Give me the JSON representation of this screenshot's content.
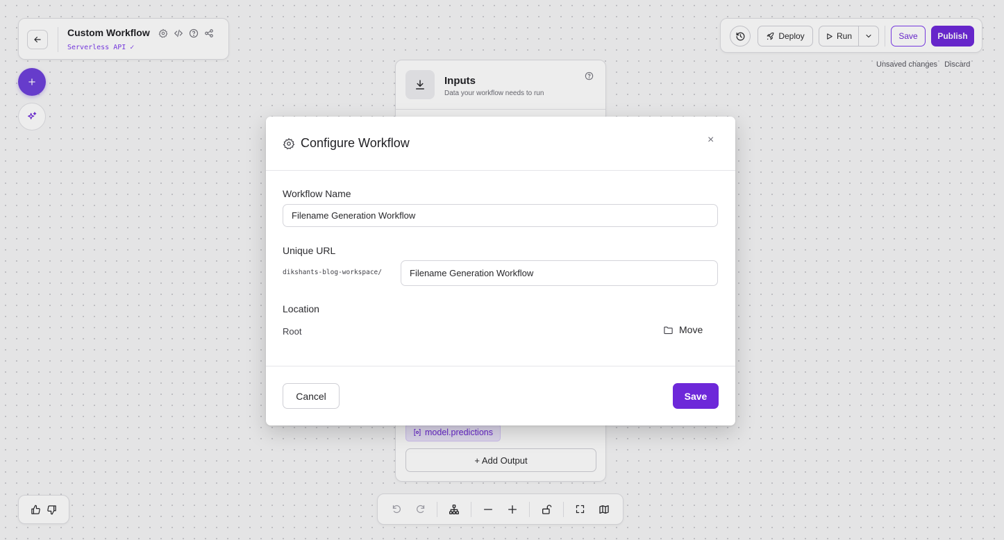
{
  "header": {
    "title": "Custom Workflow",
    "subtitle": "Serverless API ✓"
  },
  "toolbar": {
    "deploy_label": "Deploy",
    "run_label": "Run",
    "save_label": "Save",
    "publish_label": "Publish",
    "unsaved_text": "Unsaved changes",
    "discard_label": "Discard"
  },
  "canvas": {
    "inputs_node": {
      "title": "Inputs",
      "subtitle": "Data your workflow needs to run"
    },
    "outputs_node": {
      "chip_label": "model.predictions",
      "add_output_label": "+ Add Output"
    }
  },
  "modal": {
    "title": "Configure Workflow",
    "close_glyph": "×",
    "workflow_name_label": "Workflow Name",
    "workflow_name_value": "Filename Generation Workflow",
    "unique_url_label": "Unique URL",
    "url_prefix": "dikshants-blog-workspace/",
    "url_value": "Filename Generation Workflow",
    "location_label": "Location",
    "location_value": "Root",
    "move_label": "Move",
    "cancel_label": "Cancel",
    "save_label": "Save"
  },
  "icons": {
    "back": "arrow-left-icon",
    "settings": "gear-icon",
    "code": "code-icon",
    "help": "question-circle-icon",
    "share": "share-icon",
    "history": "history-icon",
    "deploy": "rocket-icon",
    "run": "play-icon",
    "dropdown": "chevron-down-icon",
    "add": "plus-icon",
    "ai": "sparkles-icon",
    "download": "download-icon",
    "folder": "folder-icon",
    "undo": "undo-icon",
    "redo": "redo-icon",
    "tree": "hierarchy-icon",
    "zoom_out": "minus-icon",
    "zoom_in": "plus-icon",
    "lock": "unlock-icon",
    "fit": "fullscreen-icon",
    "map": "map-icon",
    "like": "thumbs-up-icon",
    "dislike": "thumbs-down-icon"
  },
  "colors": {
    "accent": "#6d28d9",
    "accent_light": "#ede6fd",
    "subtitle_mono": "#7c3aed"
  }
}
